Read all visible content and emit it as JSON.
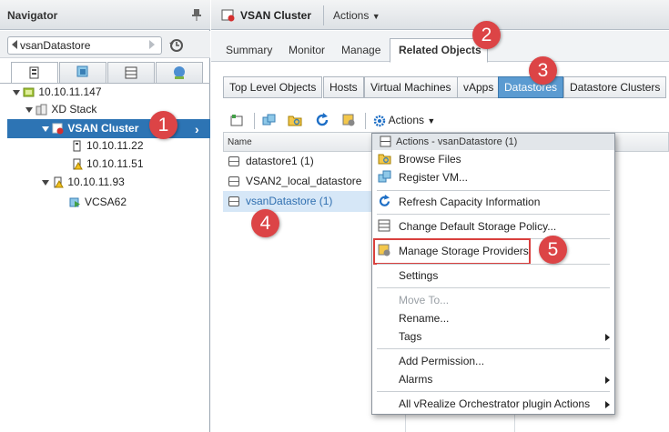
{
  "navigator": {
    "title": "Navigator",
    "back_label": "vsanDatastore",
    "tree": {
      "host_top": "10.10.11.147",
      "xd_stack": "XD Stack",
      "cluster": "VSAN Cluster",
      "host_a": "10.10.11.22",
      "host_b": "10.10.11.51",
      "host_c": "10.10.11.93",
      "vm": "VCSA62"
    }
  },
  "main": {
    "title": "VSAN Cluster",
    "actions_label": "Actions",
    "tabs": [
      "Summary",
      "Monitor",
      "Manage",
      "Related Objects"
    ],
    "subtabs": [
      "Top Level Objects",
      "Hosts",
      "Virtual Machines",
      "vApps",
      "Datastores",
      "Datastore Clusters"
    ],
    "toolbar_actions": "Actions",
    "grid": {
      "col_name": "Name",
      "rows": [
        "datastore1 (1)",
        "VSAN2_local_datastore",
        "vsanDatastore (1)"
      ]
    }
  },
  "menu": {
    "title": "Actions - vsanDatastore (1)",
    "items": [
      "Browse Files",
      "Register VM...",
      "Refresh Capacity Information",
      "Change Default Storage Policy...",
      "Manage Storage Providers",
      "Settings",
      "Move To...",
      "Rename...",
      "Tags",
      "Add Permission...",
      "Alarms",
      "All vRealize Orchestrator plugin Actions"
    ]
  },
  "callouts": [
    "1",
    "2",
    "3",
    "4",
    "5"
  ],
  "colors": {
    "selection": "#2d74b4",
    "callout": "#dc4446",
    "active_subtab": "#5b9bd1"
  }
}
